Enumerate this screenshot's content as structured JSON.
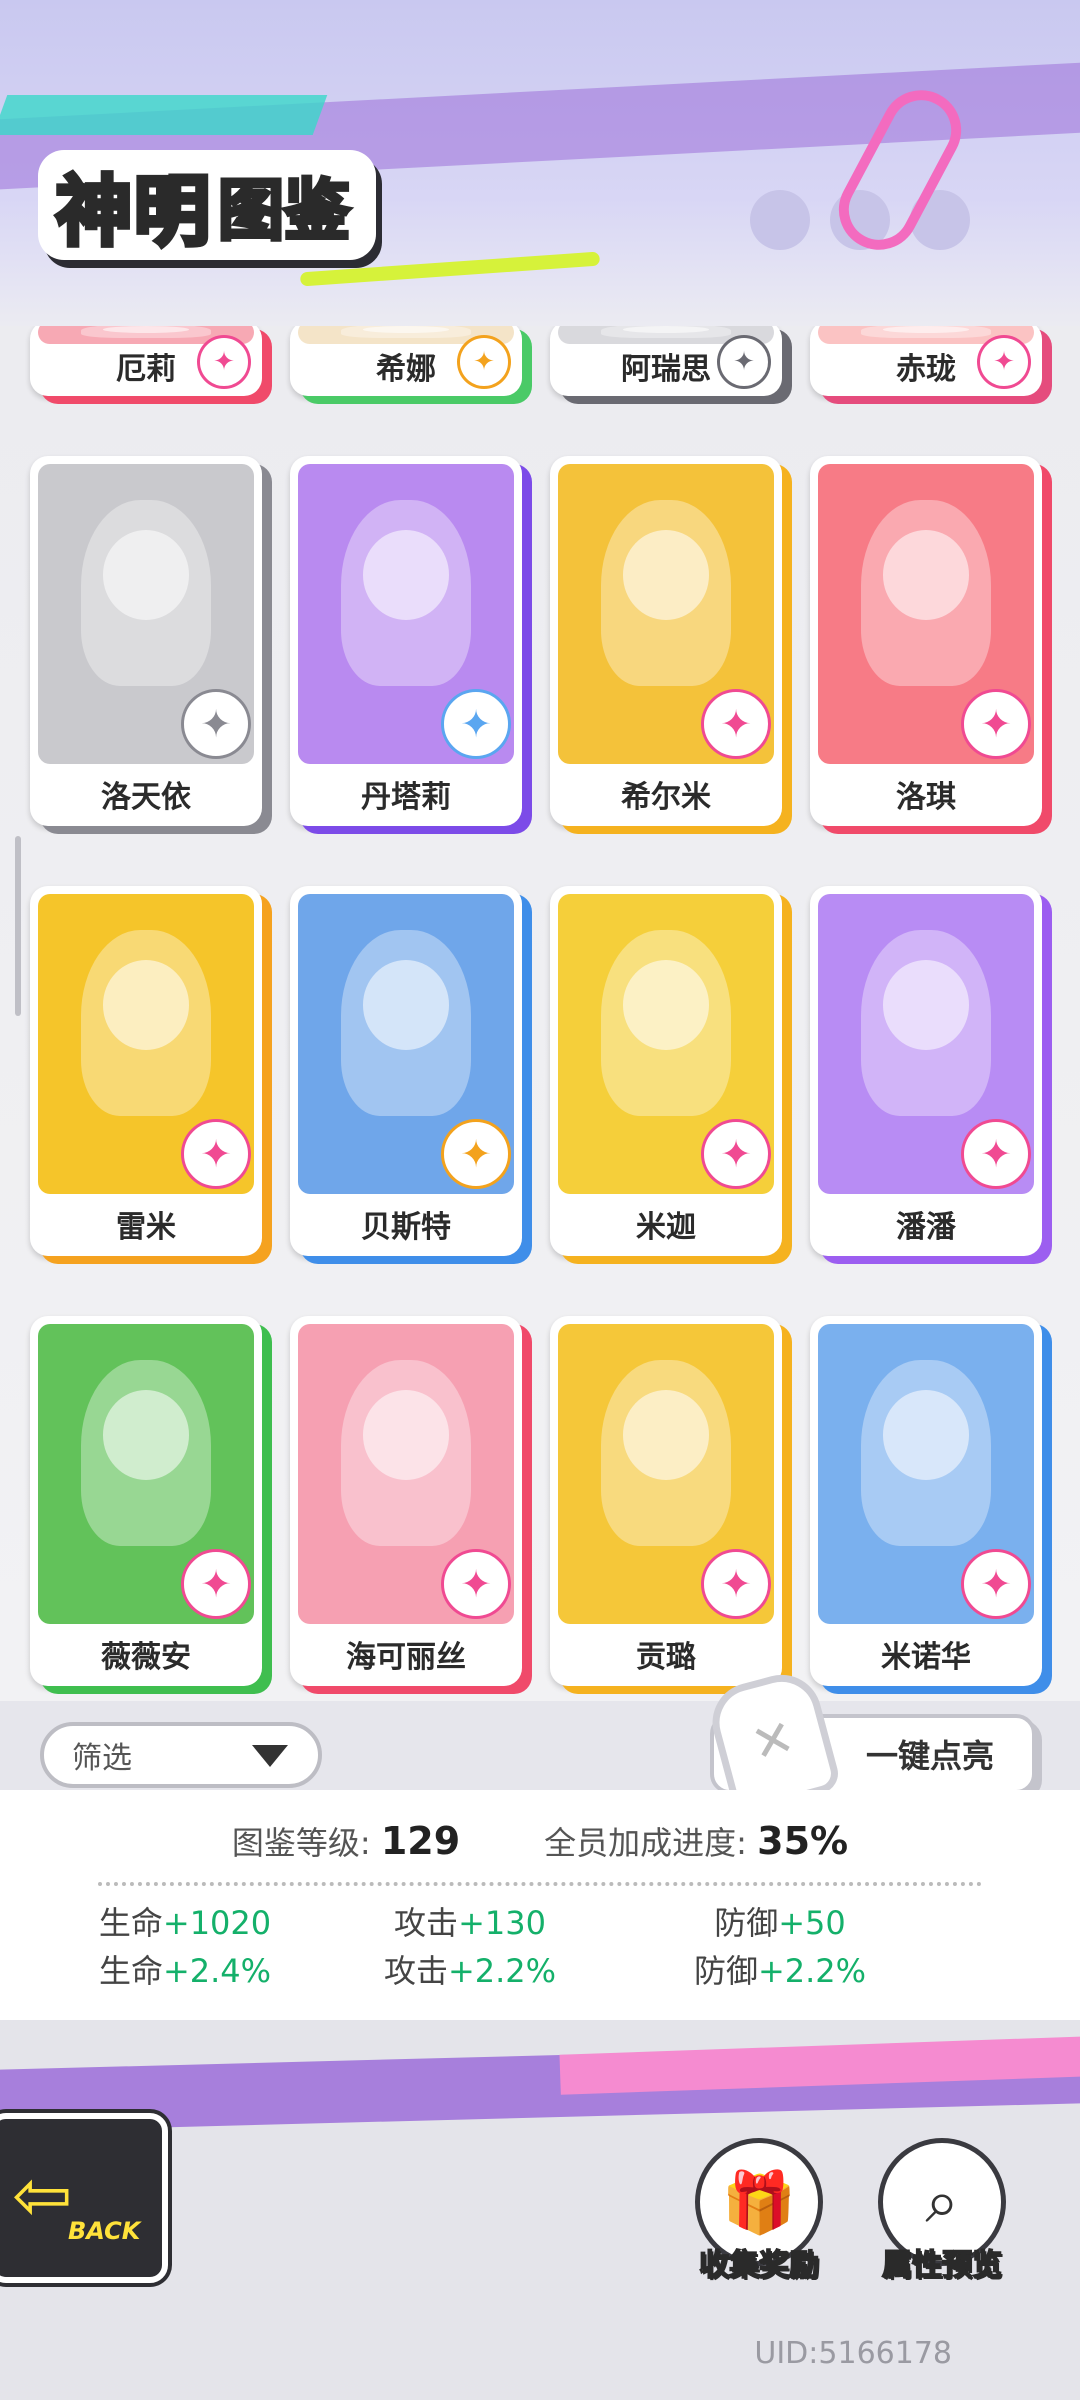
{
  "header": {
    "title_main": "神明",
    "title_sub": "图鉴"
  },
  "cards": [
    {
      "name": "厄莉",
      "accent": "#f04a6a",
      "bg": "#f7a9b4",
      "badge": "#f04a92",
      "badge_icon": "✦"
    },
    {
      "name": "希娜",
      "accent": "#4aca67",
      "bg": "#f4e4c8",
      "badge": "#f3a21d",
      "badge_icon": "✦"
    },
    {
      "name": "阿瑞思",
      "accent": "#6a6a72",
      "bg": "#d9d9dd",
      "badge": "#6a6a72",
      "badge_icon": "✦"
    },
    {
      "name": "赤珑",
      "accent": "#e54c7d",
      "bg": "#fbc3c3",
      "badge": "#f04a92",
      "badge_icon": "✦"
    },
    {
      "name": "洛天依",
      "accent": "#8a8a92",
      "bg": "#c9c9cd",
      "badge": "#8a8a92",
      "badge_icon": "✦"
    },
    {
      "name": "丹塔莉",
      "accent": "#7c4be8",
      "bg": "#b98af0",
      "badge": "#5aa6f0",
      "badge_icon": "✦"
    },
    {
      "name": "希尔米",
      "accent": "#f5b21f",
      "bg": "#f4c23a",
      "badge": "#f04a92",
      "badge_icon": "✦"
    },
    {
      "name": "洛琪",
      "accent": "#f04a6a",
      "bg": "#f77b86",
      "badge": "#f04a92",
      "badge_icon": "✦"
    },
    {
      "name": "雷米",
      "accent": "#f5a21f",
      "bg": "#f5c52a",
      "badge": "#f04a92",
      "badge_icon": "✦"
    },
    {
      "name": "贝斯特",
      "accent": "#3f8ee9",
      "bg": "#6fa6ea",
      "badge": "#f3a21d",
      "badge_icon": "✦"
    },
    {
      "name": "米迦",
      "accent": "#f5b21f",
      "bg": "#f5cf3a",
      "badge": "#f04a92",
      "badge_icon": "✦"
    },
    {
      "name": "潘潘",
      "accent": "#9c5ef0",
      "bg": "#b88cf4",
      "badge": "#f04a92",
      "badge_icon": "✦"
    },
    {
      "name": "薇薇安",
      "accent": "#3fbe4f",
      "bg": "#62c25a",
      "badge": "#f04a92",
      "badge_icon": "✦"
    },
    {
      "name": "海可丽丝",
      "accent": "#f04a6a",
      "bg": "#f6a0b2",
      "badge": "#f04a92",
      "badge_icon": "✦"
    },
    {
      "name": "贡璐",
      "accent": "#f5b21f",
      "bg": "#f5c739",
      "badge": "#f04a92",
      "badge_icon": "✦"
    },
    {
      "name": "米诺华",
      "accent": "#3f8ee9",
      "bg": "#7ab0ee",
      "badge": "#f04a92",
      "badge_icon": "✦"
    }
  ],
  "filter": {
    "label": "筛选"
  },
  "light_all": {
    "label": "一键点亮"
  },
  "stats": {
    "level_label": "图鉴等级:",
    "level_value": "129",
    "progress_label": "全员加成进度:",
    "progress_value": "35%",
    "rows": [
      [
        {
          "label": "生命",
          "value": "+1020"
        },
        {
          "label": "攻击",
          "value": "+130"
        },
        {
          "label": "防御",
          "value": "+50"
        }
      ],
      [
        {
          "label": "生命",
          "value": "+2.4%"
        },
        {
          "label": "攻击",
          "value": "+2.2%"
        },
        {
          "label": "防御",
          "value": "+2.2%"
        }
      ]
    ]
  },
  "bottom": {
    "back_label": "BACK",
    "collect_reward_label": "收集奖励",
    "attr_preview_label": "属性预览",
    "uid": "UID:5166178"
  }
}
